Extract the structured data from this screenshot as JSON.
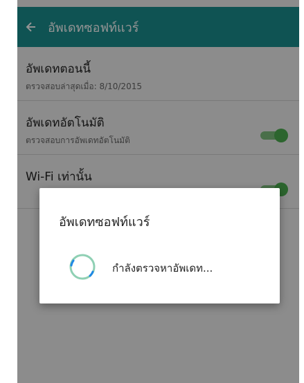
{
  "header": {
    "title": "อัพเดทซอฟท์แวร์"
  },
  "settings": {
    "items": [
      {
        "label": "อัพเดทตอนนี้",
        "sub": "ตรวจสอบล่าสุดเมื่อ: 8/10/2015",
        "toggle": null
      },
      {
        "label": "อัพเดทอัตโนมัติ",
        "sub": "ตรวจสอบการอัพเดทอัตโนมัติ",
        "toggle": "on"
      },
      {
        "label": "Wi-Fi เท่านั้น",
        "sub": "",
        "toggle": "on"
      }
    ]
  },
  "dialog": {
    "title": "อัพเดทซอฟท์แวร์",
    "message": "กำลังตรวจหาอัพเดท..."
  },
  "colors": {
    "accent": "#1a8f8f",
    "toggle_on": "#4caf50"
  }
}
